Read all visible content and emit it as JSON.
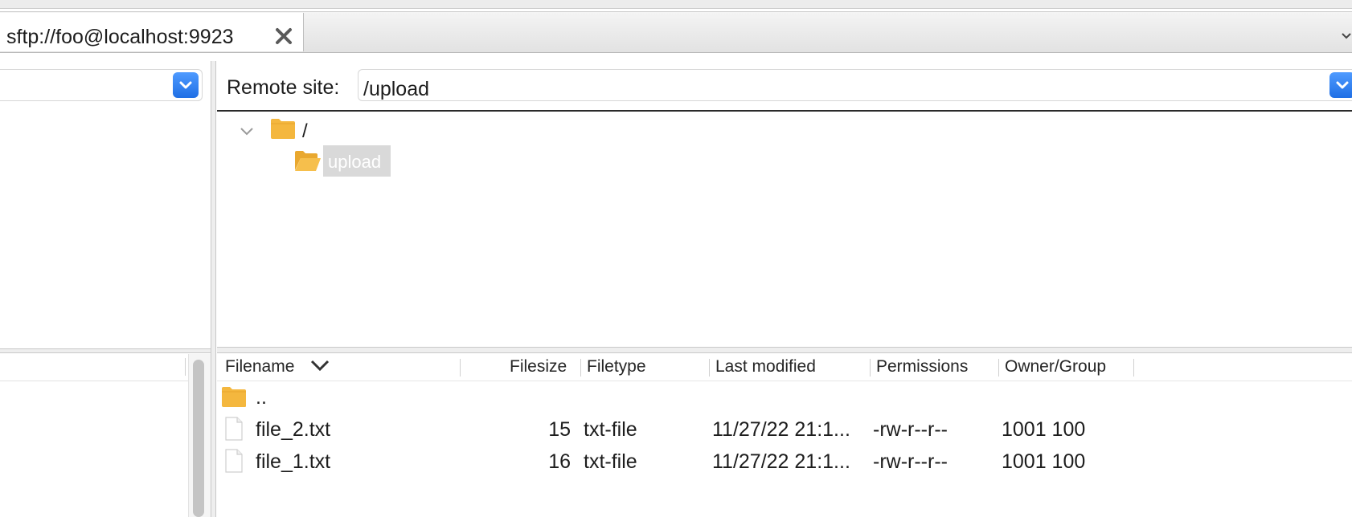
{
  "tab": {
    "title": "sftp://foo@localhost:9923",
    "close_icon": "close-icon",
    "overflow_icon": "chevron-down-icon"
  },
  "remote": {
    "label": "Remote site:",
    "path": "/upload",
    "dropdown_icon": "chevron-down-icon"
  },
  "tree": {
    "root": "/",
    "child": "upload"
  },
  "columns": {
    "filename": "Filename",
    "filesize": "Filesize",
    "filetype": "Filetype",
    "last_modified": "Last modified",
    "permissions": "Permissions",
    "owner_group": "Owner/Group"
  },
  "files": [
    {
      "name": "..",
      "size": "",
      "type": "",
      "modified": "",
      "perms": "",
      "owner": "",
      "icon": "folder-icon"
    },
    {
      "name": "file_2.txt",
      "size": "15",
      "type": "txt-file",
      "modified": "11/27/22 21:1...",
      "perms": "-rw-r--r--",
      "owner": "1001 100",
      "icon": "file-icon"
    },
    {
      "name": "file_1.txt",
      "size": "16",
      "type": "txt-file",
      "modified": "11/27/22 21:1...",
      "perms": "-rw-r--r--",
      "owner": "1001 100",
      "icon": "file-icon"
    }
  ],
  "colors": {
    "accent": "#1f6fe5",
    "folder": "#f4b73e",
    "selection": "#d9d9d9"
  }
}
